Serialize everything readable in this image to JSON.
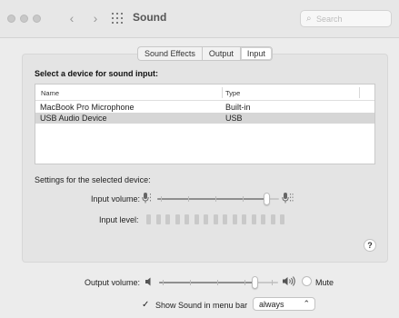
{
  "window": {
    "title": "Sound",
    "search_placeholder": "Search",
    "back_glyph": "‹",
    "forward_glyph": "›",
    "search_icon": "⌕"
  },
  "tabs": [
    {
      "label": "Sound Effects",
      "active": false
    },
    {
      "label": "Output",
      "active": false
    },
    {
      "label": "Input",
      "active": true
    }
  ],
  "input": {
    "section_label": "Select a device for sound input:",
    "columns": [
      "Name",
      "Type"
    ],
    "devices": [
      {
        "name": "MacBook Pro Microphone",
        "type": "Built-in",
        "selected": false
      },
      {
        "name": "USB Audio Device",
        "type": "USB",
        "selected": true
      }
    ],
    "settings_label": "Settings for the selected device:",
    "input_volume_label": "Input volume:",
    "input_volume": 0.92,
    "input_level_label": "Input level:",
    "input_level_segments": 15,
    "input_level_active": 0,
    "help_label": "?"
  },
  "output": {
    "output_volume_label": "Output volume:",
    "output_volume": 0.82,
    "mute_label": "Mute",
    "mute_checked": false,
    "menu_bar_checkbox_label": "Show Sound in menu bar",
    "menu_bar_checked": true,
    "menu_bar_option": "always"
  },
  "colors": {
    "selected_row": "#d6d6d6",
    "panel_bg": "#e4e4e4",
    "window_bg": "#ececec"
  }
}
